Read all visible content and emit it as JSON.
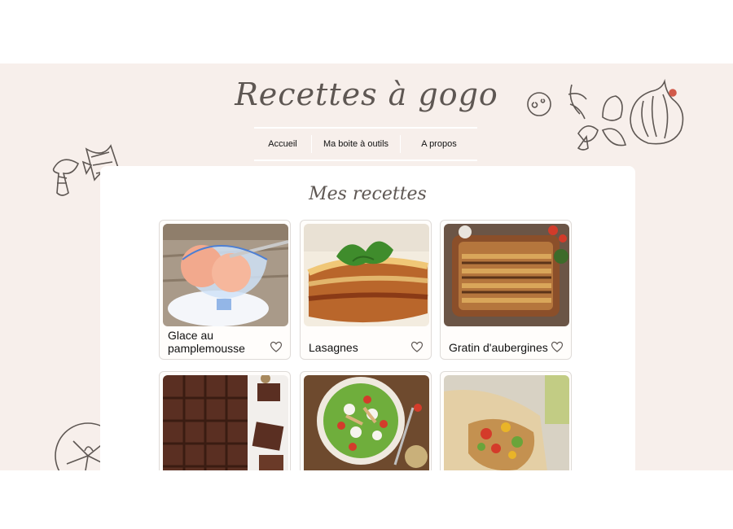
{
  "site": {
    "title": "Recettes à gogo"
  },
  "nav": {
    "items": [
      "Accueil",
      "Ma boite à outils",
      "A propos"
    ]
  },
  "main": {
    "title": "Mes recettes",
    "recipes": [
      {
        "title": "Glace au pamplemousse",
        "image": "grapefruit-sorbet-photo"
      },
      {
        "title": "Lasagnes",
        "image": "lasagna-photo"
      },
      {
        "title": "Gratin d'aubergines",
        "image": "eggplant-gratin-photo"
      },
      {
        "title": "",
        "image": "brownies-photo"
      },
      {
        "title": "",
        "image": "mozzarella-salad-photo"
      },
      {
        "title": "",
        "image": "wrap-photo"
      }
    ]
  },
  "icons": {
    "favorite": "heart-outline-icon"
  },
  "colors": {
    "page_background": "#f7efeb",
    "panel": "#ffffff",
    "title": "#5e5753"
  }
}
